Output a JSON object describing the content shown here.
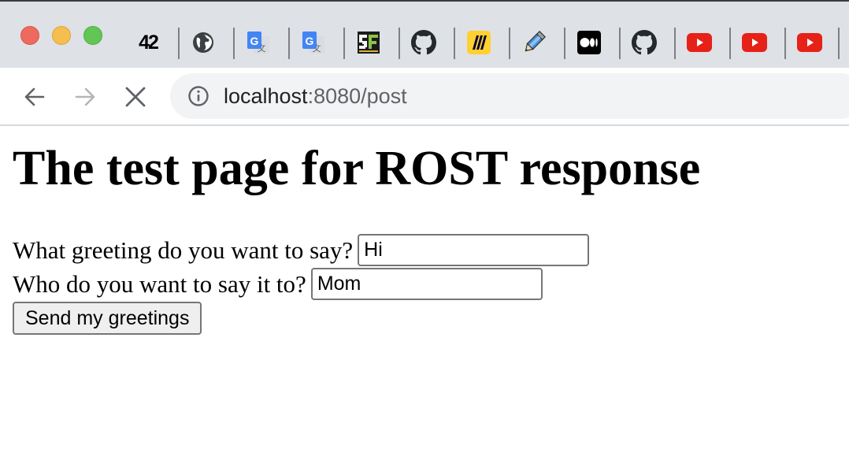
{
  "tabs": [
    {
      "icon": "42-logo-icon",
      "label": "42"
    },
    {
      "icon": "globe-icon"
    },
    {
      "icon": "google-translate-icon",
      "label": "G"
    },
    {
      "icon": "google-translate-icon",
      "label": "G"
    },
    {
      "icon": "pixel-game-icon"
    },
    {
      "icon": "github-icon"
    },
    {
      "icon": "miro-icon"
    },
    {
      "icon": "pencil-icon"
    },
    {
      "icon": "medium-icon"
    },
    {
      "icon": "github-icon"
    },
    {
      "icon": "youtube-icon"
    },
    {
      "icon": "youtube-icon"
    },
    {
      "icon": "youtube-icon"
    }
  ],
  "address_bar": {
    "host": "localhost",
    "rest": ":8080/post"
  },
  "page": {
    "heading": "The test page for ROST response",
    "greeting_label": "What greeting do you want to say?",
    "greeting_value": "Hi",
    "recipient_label": "Who do you want to say it to?",
    "recipient_value": "Mom",
    "submit_label": "Send my greetings"
  },
  "colors": {
    "tabstrip": "#dee1e6",
    "omnibox": "#f1f3f4",
    "youtube": "#e62117"
  }
}
